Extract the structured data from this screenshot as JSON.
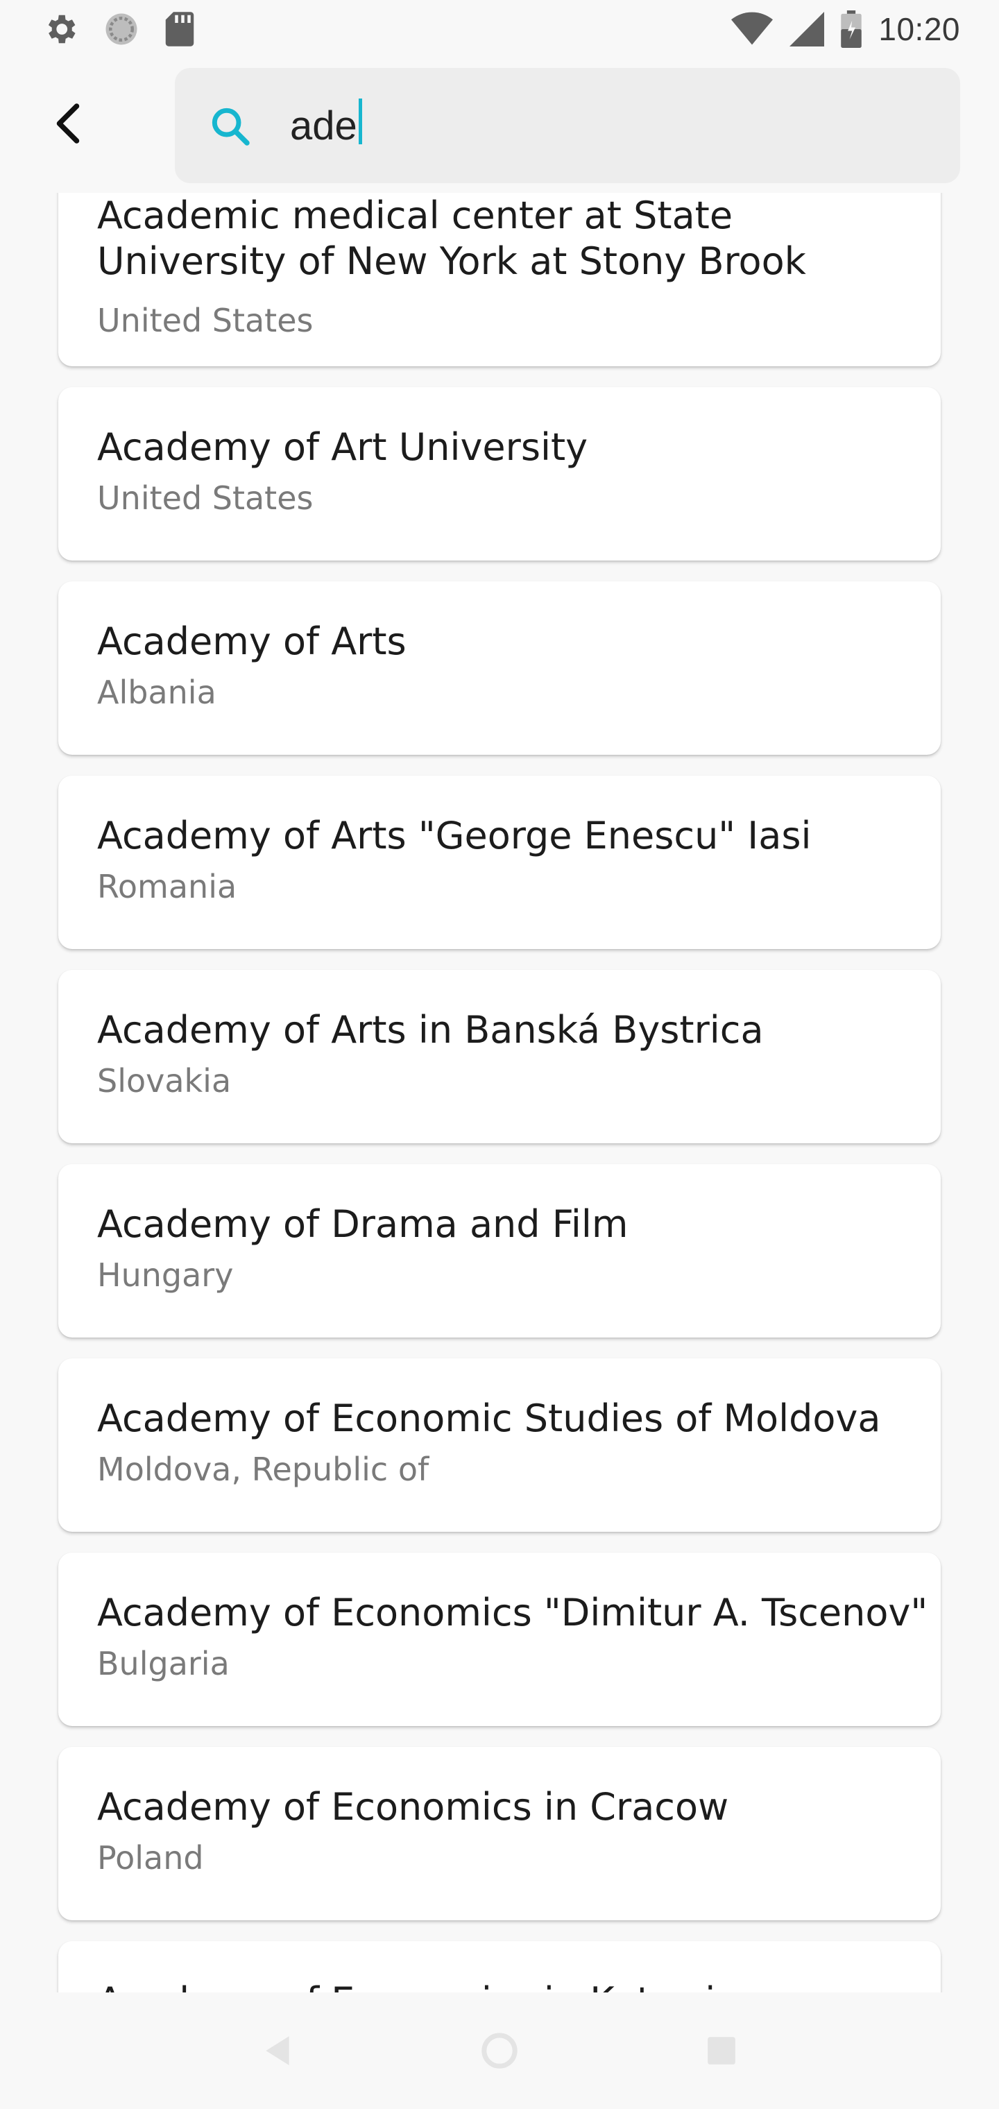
{
  "status_bar": {
    "time": "10:20",
    "left_icons": [
      "gear-icon",
      "sync-circle-icon",
      "sd-card-icon"
    ],
    "right_icons": [
      "wifi-icon",
      "signal-icon",
      "battery-icon"
    ]
  },
  "search": {
    "value": "ade",
    "icon": "search-icon",
    "accent_color": "#17b6cf"
  },
  "results": [
    {
      "name": "Academic medical center at State University of New York at Stony Brook",
      "country": "United States"
    },
    {
      "name": "Academy of Art University",
      "country": "United States"
    },
    {
      "name": "Academy of Arts",
      "country": "Albania"
    },
    {
      "name": "Academy of Arts \"George Enescu\" Iasi",
      "country": "Romania"
    },
    {
      "name": "Academy of Arts in Banská Bystrica",
      "country": "Slovakia"
    },
    {
      "name": "Academy of Drama and Film",
      "country": "Hungary"
    },
    {
      "name": "Academy of Economic Studies of Moldova",
      "country": "Moldova, Republic of"
    },
    {
      "name": "Academy of Economics \"Dimitur A. Tscenov\"",
      "country": "Bulgaria"
    },
    {
      "name": "Academy of Economics in Cracow",
      "country": "Poland"
    },
    {
      "name": "Academy of Economics in Katowice",
      "country": ""
    }
  ],
  "nav_bar": {
    "icons": [
      "back-triangle-icon",
      "home-circle-icon",
      "recents-square-icon"
    ]
  }
}
